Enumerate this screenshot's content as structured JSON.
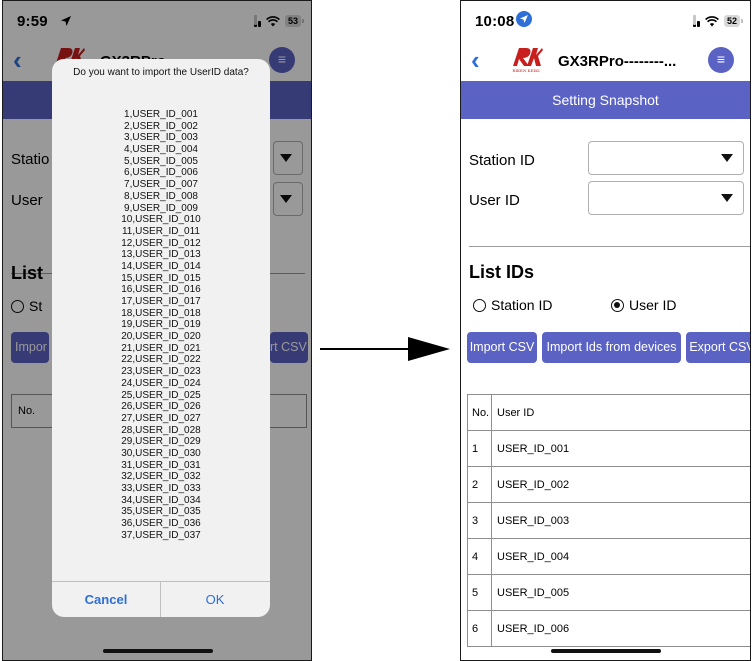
{
  "left_screen": {
    "time": "9:59",
    "battery": "53",
    "app_title": "GX3RPro",
    "logo_word": "RIKEN KEIKI",
    "labels": {
      "station": "Statio",
      "user": "User",
      "list": "List",
      "radio_station": "St",
      "import": "Impor",
      "export": "rt CSV",
      "no": "No."
    },
    "alert": {
      "title": "Do you want to import the UserID data?",
      "items": [
        "1,USER_ID_001",
        "2,USER_ID_002",
        "3,USER_ID_003",
        "4,USER_ID_004",
        "5,USER_ID_005",
        "6,USER_ID_006",
        "7,USER_ID_007",
        "8,USER_ID_008",
        "9,USER_ID_009",
        "10,USER_ID_010",
        "11,USER_ID_011",
        "12,USER_ID_012",
        "13,USER_ID_013",
        "14,USER_ID_014",
        "15,USER_ID_015",
        "16,USER_ID_016",
        "17,USER_ID_017",
        "18,USER_ID_018",
        "19,USER_ID_019",
        "20,USER_ID_020",
        "21,USER_ID_021",
        "22,USER_ID_022",
        "23,USER_ID_023",
        "24,USER_ID_024",
        "25,USER_ID_025",
        "26,USER_ID_026",
        "27,USER_ID_027",
        "28,USER_ID_028",
        "29,USER_ID_029",
        "30,USER_ID_030",
        "31,USER_ID_031",
        "32,USER_ID_032",
        "33,USER_ID_033",
        "34,USER_ID_034",
        "35,USER_ID_035",
        "36,USER_ID_036",
        "37,USER_ID_037"
      ],
      "cancel": "Cancel",
      "ok": "OK"
    }
  },
  "right_screen": {
    "time": "10:08",
    "battery": "52",
    "app_title": "GX3RPro--------...",
    "logo_word": "RIKEN KEIKI",
    "header": "Setting Snapshot",
    "station_label": "Station ID",
    "user_label": "User ID",
    "section_title": "List IDs",
    "radio_station": "Station ID",
    "radio_user": "User ID",
    "selected_radio": "User ID",
    "buttons": {
      "import_csv": "Import CSV",
      "import_devices": "Import Ids from devices",
      "export_csv": "Export CSV"
    },
    "table": {
      "headers": [
        "No.",
        "User ID"
      ],
      "rows": [
        [
          "1",
          "USER_ID_001"
        ],
        [
          "2",
          "USER_ID_002"
        ],
        [
          "3",
          "USER_ID_003"
        ],
        [
          "4",
          "USER_ID_004"
        ],
        [
          "5",
          "USER_ID_005"
        ],
        [
          "6",
          "USER_ID_006"
        ]
      ]
    }
  },
  "colors": {
    "accent": "#5a62c4",
    "link_blue": "#2f6fd8",
    "logo_red": "#c81e1e"
  },
  "icons": {
    "back": "chevron-left-icon",
    "menu": "menu-icon",
    "location": "location-arrow-icon",
    "signal": "cellular-signal-icon",
    "wifi": "wifi-icon",
    "battery": "battery-icon",
    "dropdown": "caret-down-icon"
  }
}
